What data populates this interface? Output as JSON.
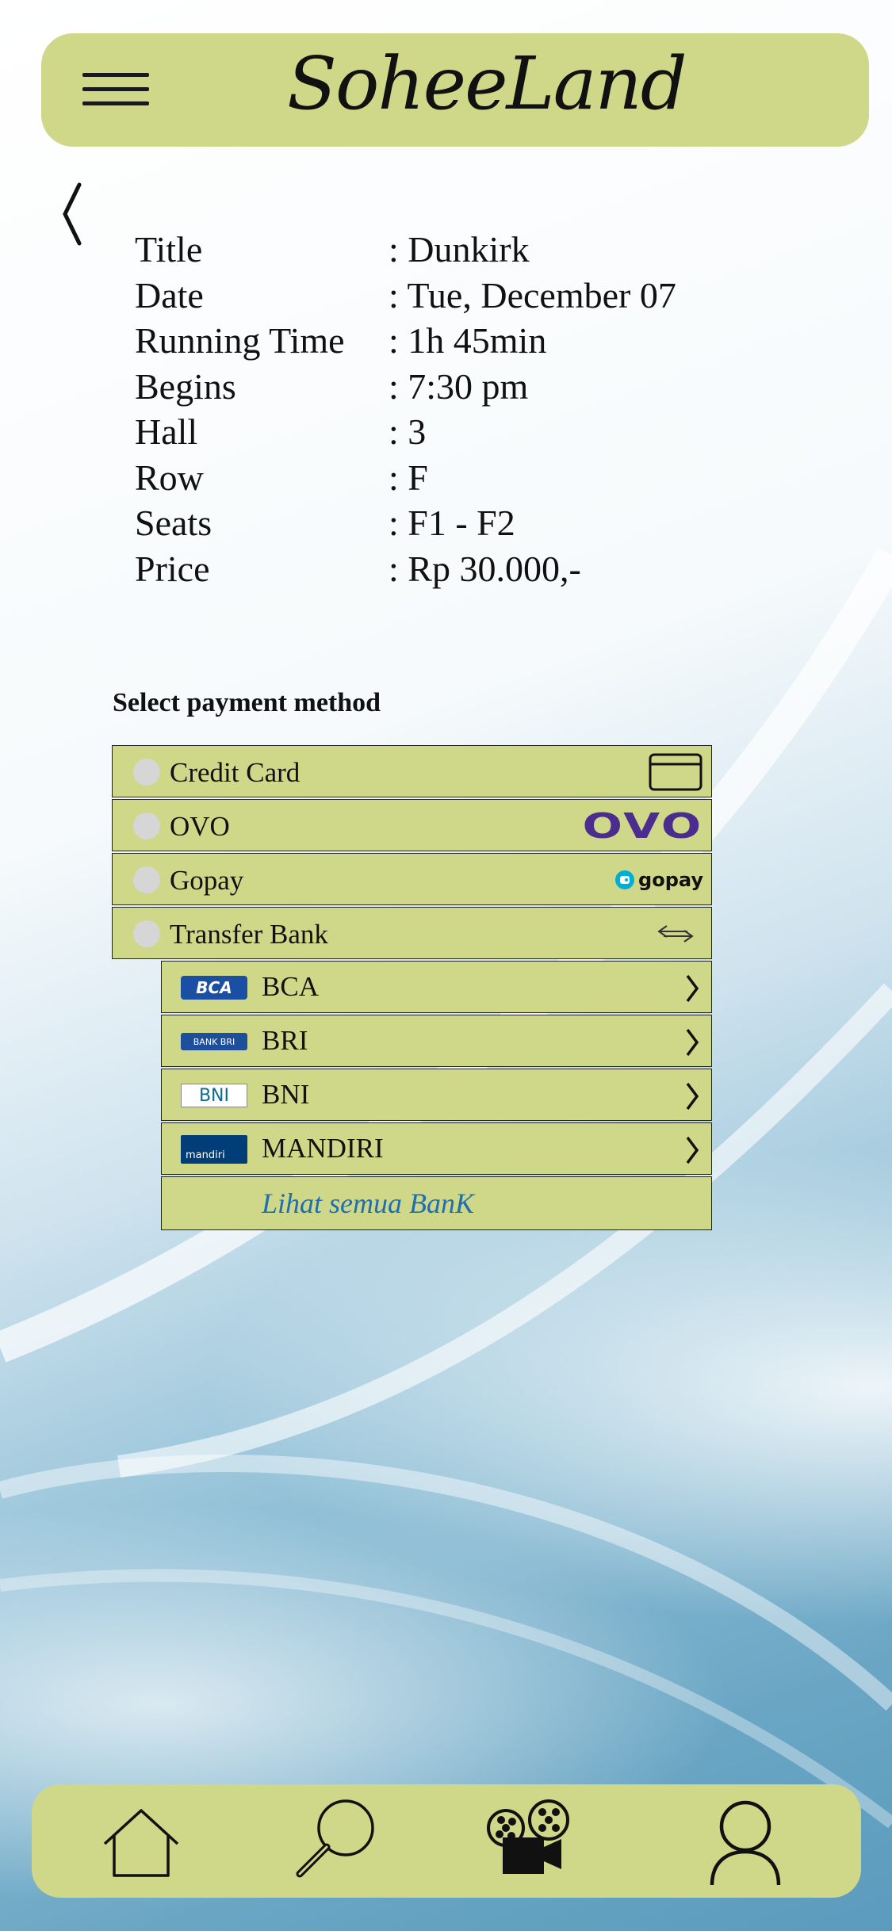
{
  "app": {
    "title": "SoheeLand"
  },
  "details": [
    {
      "label": "Title",
      "value": ": Dunkirk"
    },
    {
      "label": "Date",
      "value": ": Tue, December 07"
    },
    {
      "label": "Running Time",
      "value": ": 1h 45min"
    },
    {
      "label": "Begins",
      "value": ": 7:30 pm"
    },
    {
      "label": "Hall",
      "value": ": 3"
    },
    {
      "label": "Row",
      "value": ": F"
    },
    {
      "label": "Seats",
      "value": ": F1 - F2"
    },
    {
      "label": "Price",
      "value": ": Rp 30.000,-"
    }
  ],
  "payment": {
    "title": "Select payment method",
    "methods": [
      {
        "label": "Credit Card",
        "icon": "credit-card-icon"
      },
      {
        "label": "OVO",
        "icon": "ovo-logo",
        "logo_text": "OVO",
        "color": "#4b2c8f"
      },
      {
        "label": "Gopay",
        "icon": "gopay-logo",
        "logo_text": "gopay",
        "color": "#00aed6"
      },
      {
        "label": "Transfer Bank",
        "icon": "transfer-icon"
      }
    ],
    "banks": [
      {
        "label": "BCA",
        "logo_text": "BCA",
        "color": "#1a4fa3"
      },
      {
        "label": "BRI",
        "logo_text": "BANK BRI",
        "color": "#1e4f9c"
      },
      {
        "label": "BNI",
        "logo_text": "BNI",
        "color": "#f15a23"
      },
      {
        "label": "MANDIRI",
        "logo_text": "mandiri",
        "color": "#003d79"
      }
    ],
    "see_all": "Lihat semua BanK"
  },
  "nav": {
    "items": [
      {
        "name": "home",
        "icon": "home-icon"
      },
      {
        "name": "search",
        "icon": "search-icon"
      },
      {
        "name": "movies",
        "icon": "film-projector-icon"
      },
      {
        "name": "profile",
        "icon": "user-icon"
      }
    ]
  }
}
